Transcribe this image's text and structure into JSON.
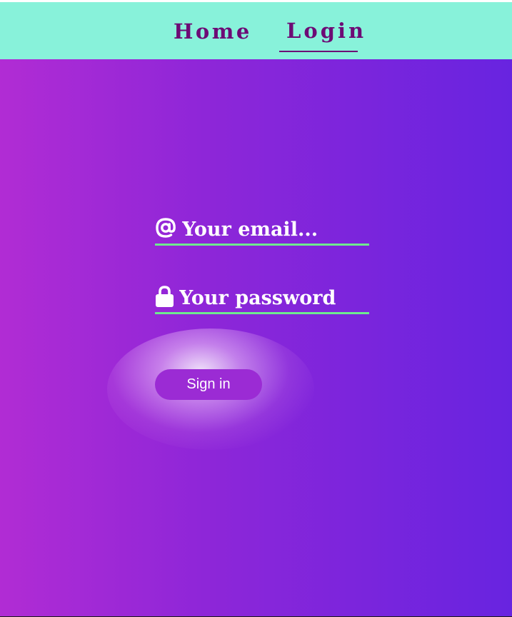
{
  "nav": {
    "home_label": "Home",
    "login_label": "Login",
    "active": "Login"
  },
  "form": {
    "email": {
      "placeholder": "Your email...",
      "value": "",
      "icon": "at-sign-icon"
    },
    "password": {
      "placeholder": "Your password",
      "value": "",
      "icon": "lock-icon"
    },
    "submit_label": "Sign in"
  },
  "colors": {
    "navbar_bg": "#88f2da",
    "nav_text": "#6d0b75",
    "gradient_start": "#b12cd4",
    "gradient_end": "#6824e0",
    "field_underline": "#6fea8e",
    "button_bg": "#9b2bd4"
  }
}
